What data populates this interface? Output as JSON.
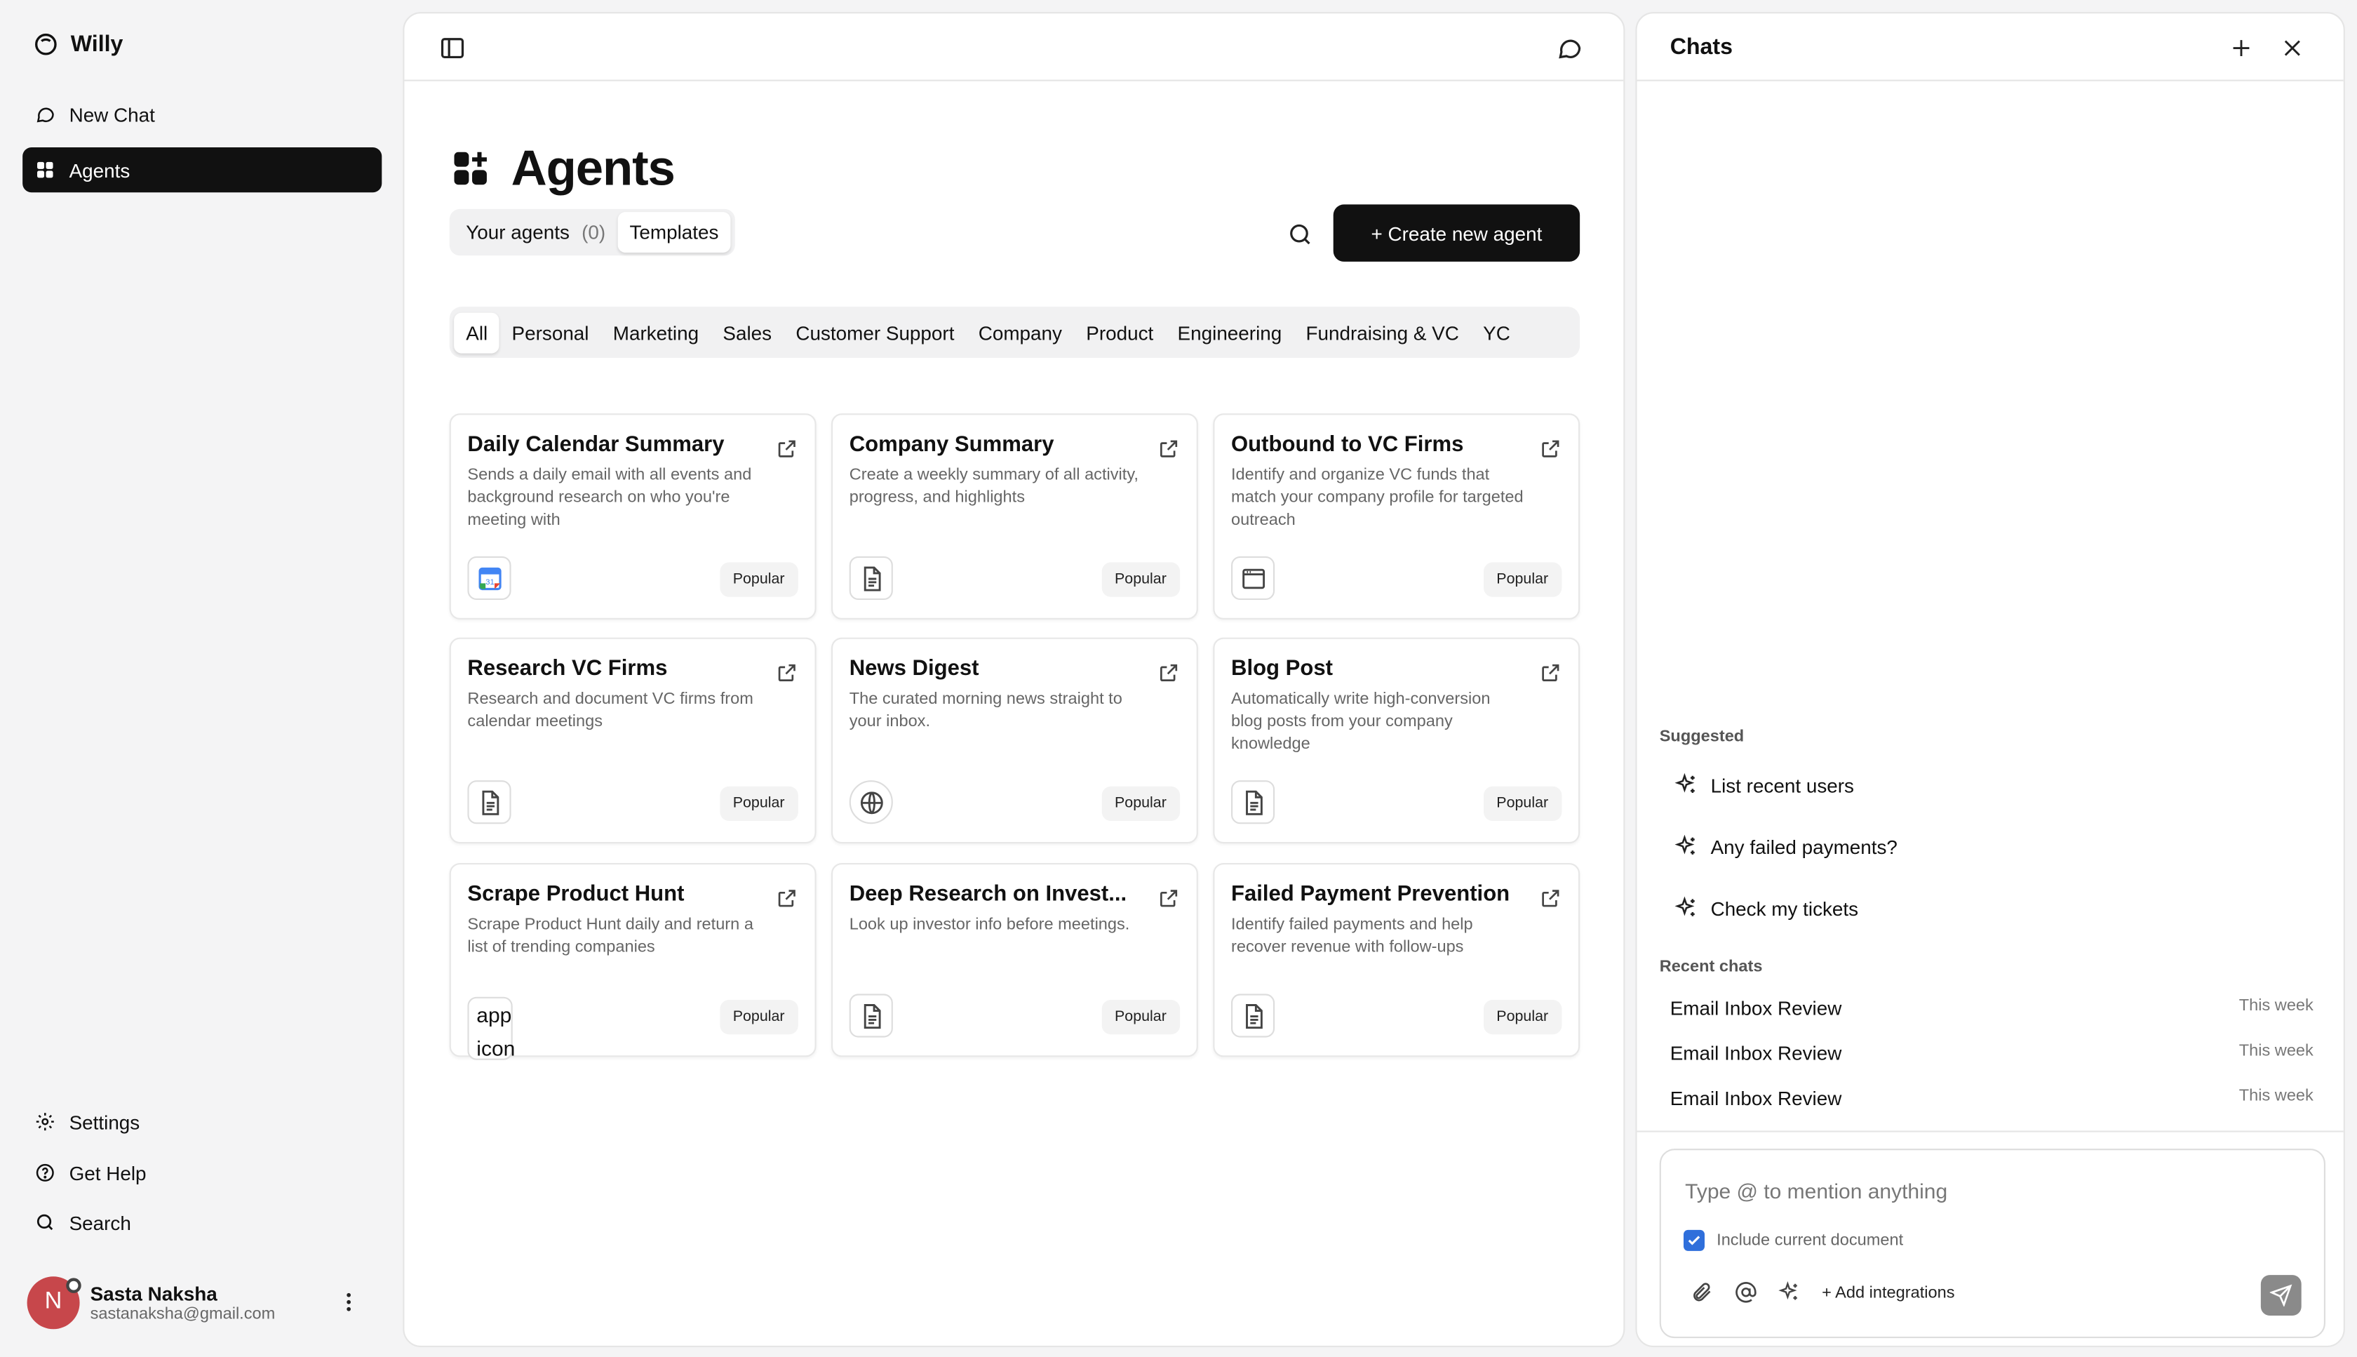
{
  "sidebar": {
    "brand": "Willy",
    "nav": [
      {
        "label": "New Chat",
        "icon": "chat-icon"
      },
      {
        "label": "Agents",
        "icon": "grid-icon"
      }
    ],
    "bottom_nav": [
      {
        "label": "Settings",
        "icon": "gear-icon"
      },
      {
        "label": "Get Help",
        "icon": "help-icon"
      },
      {
        "label": "Search",
        "icon": "search-icon"
      }
    ],
    "user": {
      "initial": "N",
      "name": "Sasta Naksha",
      "email": "sastanaksha@gmail.com"
    }
  },
  "main": {
    "title": "Agents",
    "tabs": {
      "your_agents": "Your agents",
      "count": "(0)",
      "templates": "Templates"
    },
    "create_button": "+ Create new agent",
    "filters": [
      "All",
      "Personal",
      "Marketing",
      "Sales",
      "Customer Support",
      "Company",
      "Product",
      "Engineering",
      "Fundraising & VC",
      "YC"
    ],
    "cards": [
      {
        "title": "Daily Calendar Summary",
        "desc": "Sends a daily email with all events and background research on who you're meeting with",
        "badge": "Popular",
        "icon": "calendar-icon"
      },
      {
        "title": "Company Summary",
        "desc": "Create a weekly summary of all activity, progress, and highlights",
        "badge": "Popular",
        "icon": "document-icon"
      },
      {
        "title": "Outbound to VC Firms",
        "desc": "Identify and organize VC funds that match your company profile for targeted outreach",
        "badge": "Popular",
        "icon": "browser-icon"
      },
      {
        "title": "Research VC Firms",
        "desc": "Research and document VC firms from calendar meetings",
        "badge": "Popular",
        "icon": "document-icon"
      },
      {
        "title": "News Digest",
        "desc": "The curated morning news straight to your inbox.",
        "badge": "Popular",
        "icon": "globe-icon"
      },
      {
        "title": "Blog Post",
        "desc": "Automatically write high-conversion blog posts from your company knowledge",
        "badge": "Popular",
        "icon": "document-icon"
      },
      {
        "title": "Scrape Product Hunt",
        "desc": "Scrape Product Hunt daily and return a list of trending companies",
        "badge": "Popular",
        "icon_alt": "app icon"
      },
      {
        "title": "Deep Research on Invest...",
        "desc": "Look up investor info before meetings.",
        "badge": "Popular",
        "icon": "document-icon"
      },
      {
        "title": "Failed Payment Prevention",
        "desc": "Identify failed payments and help recover revenue with follow-ups",
        "badge": "Popular",
        "icon": "document-icon"
      }
    ]
  },
  "chats": {
    "title": "Chats",
    "suggested_label": "Suggested",
    "suggested": [
      "List recent users",
      "Any failed payments?",
      "Check my tickets"
    ],
    "recent_label": "Recent chats",
    "recent": [
      {
        "title": "Email Inbox Review",
        "when": "This week"
      },
      {
        "title": "Email Inbox Review",
        "when": "This week"
      },
      {
        "title": "Email Inbox Review",
        "when": "This week"
      }
    ],
    "composer": {
      "placeholder": "Type @ to mention anything",
      "checkbox_label": "Include current document",
      "add_integrations": "+ Add integrations"
    }
  }
}
